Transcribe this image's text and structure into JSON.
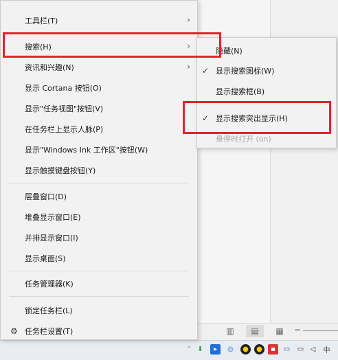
{
  "context_menu": {
    "items": [
      {
        "label": "工具栏(T)",
        "has_submenu": true
      },
      {
        "label": "搜索(H)",
        "has_submenu": true
      },
      {
        "label": "资讯和兴趣(N)",
        "has_submenu": true
      },
      {
        "label": "显示 Cortana 按钮(O)"
      },
      {
        "label": "显示\"任务视图\"按钮(V)"
      },
      {
        "label": "在任务栏上显示人脉(P)"
      },
      {
        "label": "显示\"Windows Ink 工作区\"按钮(W)"
      },
      {
        "label": "显示触摸键盘按钮(Y)"
      },
      {
        "label": "层叠窗口(D)"
      },
      {
        "label": "堆叠显示窗口(E)"
      },
      {
        "label": "并排显示窗口(I)"
      },
      {
        "label": "显示桌面(S)"
      },
      {
        "label": "任务管理器(K)"
      },
      {
        "label": "锁定任务栏(L)"
      },
      {
        "label": "任务栏设置(T)"
      }
    ],
    "arrow_glyph": "›",
    "gear_icon": "gear-icon"
  },
  "search_submenu": {
    "items": [
      {
        "label": "隐藏(N)",
        "checked": false,
        "disabled": false
      },
      {
        "label": "显示搜索图标(W)",
        "checked": true,
        "disabled": false
      },
      {
        "label": "显示搜索框(B)",
        "checked": false,
        "disabled": false
      },
      {
        "label": "显示搜索突出显示(H)",
        "checked": true,
        "disabled": false
      },
      {
        "label": "悬停时打开 (on)",
        "checked": false,
        "disabled": true
      }
    ],
    "check_glyph": "✓"
  },
  "annotation": {
    "color": "#e8202c"
  },
  "statusbar": {
    "zoom_minus": "−"
  }
}
